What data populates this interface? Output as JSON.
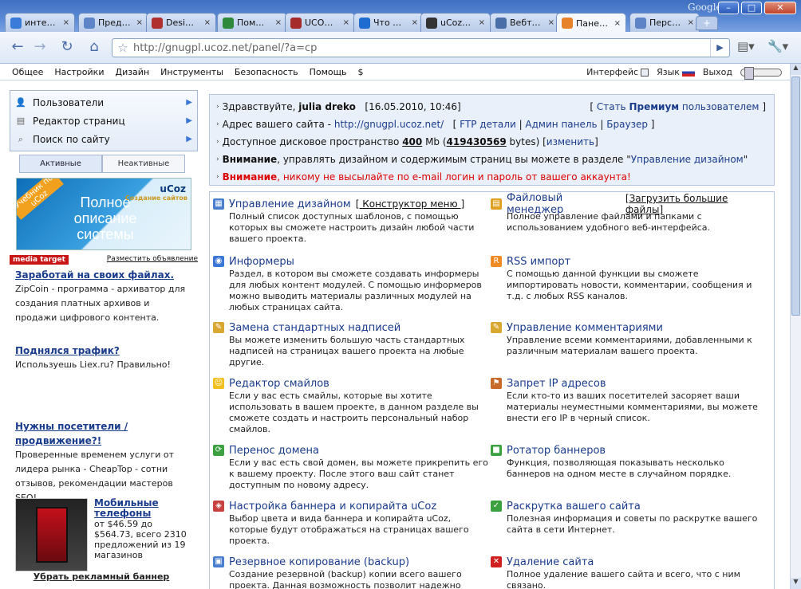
{
  "browser": {
    "google_label": "Google",
    "tabs": [
      {
        "label": "инте…",
        "color": "#3a7ad9"
      },
      {
        "label": "Пред…",
        "color": "#5d84c6"
      },
      {
        "label": "Desi…",
        "color": "#b03030"
      },
      {
        "label": "Пом…",
        "color": "#2e8a3a"
      },
      {
        "label": "UCO…",
        "color": "#a52a2a"
      },
      {
        "label": "Что …",
        "color": "#1f6cd1"
      },
      {
        "label": "uCoz…",
        "color": "#333333"
      },
      {
        "label": "Вебт…",
        "color": "#4a6ea8"
      },
      {
        "label": "Пане…",
        "color": "#e8822a"
      },
      {
        "label": "Перс…",
        "color": "#5d84c6"
      }
    ],
    "tab_close": "×",
    "new_tab": "+",
    "url": "http://gnugpl.ucoz.net/panel/?a=cp",
    "win_min": "–",
    "win_max": "□",
    "win_close": "✕"
  },
  "menu": {
    "items": [
      "Общее",
      "Настройки",
      "Дизайн",
      "Инструменты",
      "Безопасность",
      "Помощь",
      "$"
    ],
    "interface_label": "Интерфейс",
    "lang_label": "Язык",
    "exit_label": "Выход"
  },
  "sidebar": {
    "items": [
      "Пользователи",
      "Редактор страниц",
      "Поиск по сайту"
    ],
    "tab_active": "Активные",
    "tab_inactive": "Неактивные"
  },
  "banner": {
    "ribbon": "Учебник по uCoz",
    "text": "Полное описание системы",
    "logo": "uCoz",
    "logo_sub": "Создание сайтов"
  },
  "media": {
    "label": "media target",
    "place_ad": "Разместить объявление"
  },
  "ads": [
    {
      "title": "Заработай на своих файлах.",
      "text": "ZipCoin - программа - архиватор для создания платных архивов и продажи цифрового контента."
    },
    {
      "title": "Поднялся трафик?",
      "text": "Используешь Liex.ru? Правильно!"
    },
    {
      "title": "Нужны посетители / продвижение?!",
      "text": "Проверенные временем услуги от лидера рынка - CheapTop - сотни отзывов, рекомендации мастеров SEO!"
    }
  ],
  "product": {
    "title": "Мобильные телефоны",
    "text": "от $46.59 до $564.73, всего 2310 предложений из 19 магазинов"
  },
  "remove_banner": "Убрать рекламный баннер",
  "welcome": {
    "greet": "Здравствуйте,",
    "user": "julia dreko",
    "datetime": "[16.05.2010, 10:46]",
    "premium_open": "[",
    "premium_pre": "Стать",
    "premium_bold": "Премиум",
    "premium_post": "пользователем",
    "premium_close": "]",
    "address_label": "Адрес вашего сайта -",
    "address_url": "http://gnugpl.ucoz.net/",
    "ftp": "FTP детали",
    "admin": "Админ панель",
    "browser": "Браузер",
    "disk_label": "Доступное дисковое пространство",
    "disk_mb": "400",
    "disk_unit": "Mb (",
    "disk_bytes": "419430569",
    "disk_bytes_unit": "bytes) [",
    "disk_change": "изменить",
    "disk_close": "]",
    "warn1_bold": "Внимание",
    "warn1_text": ", управлять дизайном и содержимым страниц вы можете в разделе \"",
    "warn1_link": "Управление дизайном",
    "warn1_end": "\"",
    "warn2_bold": "Внимание",
    "warn2_text": ", никому не высылайте по e-mail логин и пароль от вашего аккаунта!"
  },
  "modules": [
    {
      "title": "Управление дизайном",
      "extra": "[ Конструктор меню ]",
      "desc": "Полный список доступных шаблонов, с помощью которых вы сможете настроить дизайн любой части вашего проекта.",
      "color": "#4a7fcf",
      "icon": "▦"
    },
    {
      "title": "Файловый менеджер",
      "extra": "[Загрузить большие файлы]",
      "desc": "Полное управление файлами и папками с использованием удобного веб-интерфейса.",
      "color": "#e0a020",
      "icon": "▤"
    },
    {
      "title": "Информеры",
      "extra": "",
      "desc": "Раздел, в котором вы сможете создавать информеры для любых контент модулей. С помощью информеров можно выводить материалы различных модулей на любых страницах сайта.",
      "color": "#3b77d6",
      "icon": "◉"
    },
    {
      "title": "RSS импорт",
      "extra": "",
      "desc": "С помощью данной функции вы сможете импортировать новости, комментарии, сообщения и т.д. с любых RSS каналов.",
      "color": "#f08a24",
      "icon": "R"
    },
    {
      "title": "Замена стандартных надписей",
      "extra": "",
      "desc": "Вы можете изменить большую часть стандартных надписей на страницах вашего проекта на любые другие.",
      "color": "#d9a830",
      "icon": "✎"
    },
    {
      "title": "Управление комментариями",
      "extra": "",
      "desc": "Управление всеми комментариями, добавленными к различным материалам вашего проекта.",
      "color": "#d9a830",
      "icon": "✎"
    },
    {
      "title": "Редактор смайлов",
      "extra": "",
      "desc": "Если у вас есть смайлы, которые вы хотите использовать в вашем проекте, в данном разделе вы сможете создать и настроить персональный набор смайлов.",
      "color": "#f0c020",
      "icon": "☺"
    },
    {
      "title": "Запрет IP адресов",
      "extra": "",
      "desc": "Если кто-то из ваших посетителей засоряет ваши материалы неуместными комментариями, вы можете внести его IP в черный список.",
      "color": "#c86a2a",
      "icon": "⚑"
    },
    {
      "title": "Перенос домена",
      "extra": "",
      "desc": "Если у вас есть свой домен, вы можете прикрепить его к вашему проекту. После этого ваш сайт станет доступным по новому адресу.",
      "color": "#3aa040",
      "icon": "⟳"
    },
    {
      "title": "Ротатор баннеров",
      "extra": "",
      "desc": "Функция, позволяющая показывать несколько баннеров на одном месте в случайном порядке.",
      "color": "#3aa040",
      "icon": "■"
    },
    {
      "title": "Настройка баннера и копирайта uCoz",
      "extra": "",
      "desc": "Выбор цвета и вида баннера и копирайта uCoz, которые будут отображаться на страницах вашего проекта.",
      "color": "#c84040",
      "icon": "◈"
    },
    {
      "title": "Раскрутка вашего сайта",
      "extra": "",
      "desc": "Полезная информация и советы по раскрутке вашего сайта в сети Интернет.",
      "color": "#3aa040",
      "icon": "✓"
    },
    {
      "title": "Резервное копирование (backup)",
      "extra": "",
      "desc": "Создание резервной (backup) копии всего вашего проекта. Данная возможность позволит надежно",
      "color": "#4a7fcf",
      "icon": "▣"
    },
    {
      "title": "Удаление сайта",
      "extra": "",
      "desc": "Полное удаление вашего сайта и всего, что с ним связано.",
      "color": "#d02020",
      "icon": "✕"
    }
  ]
}
